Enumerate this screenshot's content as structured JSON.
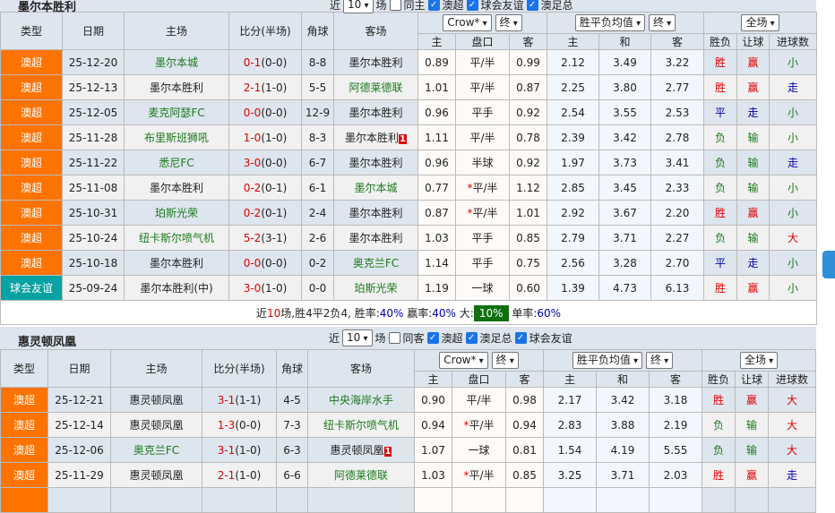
{
  "controls": {
    "recent_prefix": "近",
    "recent_count": "10",
    "recent_suffix": "场",
    "book": "Crow*",
    "stage": "终",
    "avg": "胜平负均值",
    "stage2": "终",
    "scope": "全场"
  },
  "headers": {
    "type": "类型",
    "date": "日期",
    "home": "主场",
    "score": "比分(半场)",
    "corner": "角球",
    "away": "客场",
    "h": "主",
    "line": "盘口",
    "a": "客",
    "oh": "主",
    "od": "和",
    "oa": "客",
    "wl": "胜负",
    "hc": "让球",
    "ou": "进球数"
  },
  "sections": [
    {
      "title": "墨尔本胜利",
      "same_label": "同主",
      "filters": [
        "澳超",
        "球会友谊",
        "澳足总"
      ],
      "rows": [
        [
          "澳超",
          "25-12-20",
          "墨尔本城",
          "0-1",
          "(0-0)",
          "8-8",
          "墨尔本胜利",
          "0.89",
          "平/半",
          "0.99",
          "2.12",
          "3.49",
          "3.22",
          "胜",
          "赢",
          "小"
        ],
        [
          "澳超",
          "25-12-13",
          "墨尔本胜利",
          "2-1",
          "(1-0)",
          "5-5",
          "阿德莱德联",
          "1.01",
          "平/半",
          "0.87",
          "2.25",
          "3.80",
          "2.77",
          "胜",
          "赢",
          "走"
        ],
        [
          "澳超",
          "25-12-05",
          "麦克阿瑟FC",
          "0-0",
          "(0-0)",
          "12-9",
          "墨尔本胜利",
          "0.96",
          "平手",
          "0.92",
          "2.54",
          "3.55",
          "2.53",
          "平",
          "走",
          "小"
        ],
        [
          "澳超",
          "25-11-28",
          "布里斯班狮吼",
          "1-0",
          "(1-0)",
          "8-3",
          "墨尔本胜利",
          "1.11",
          "平/半",
          "0.78",
          "2.39",
          "3.42",
          "2.78",
          "负",
          "输",
          "小"
        ],
        [
          "澳超",
          "25-11-22",
          "悉尼FC",
          "3-0",
          "(0-0)",
          "6-7",
          "墨尔本胜利",
          "0.96",
          "半球",
          "0.92",
          "1.97",
          "3.73",
          "3.41",
          "负",
          "输",
          "走"
        ],
        [
          "澳超",
          "25-11-08",
          "墨尔本胜利",
          "0-2",
          "(0-1)",
          "6-1",
          "墨尔本城",
          "0.77",
          "*平/半",
          "1.12",
          "2.85",
          "3.45",
          "2.33",
          "负",
          "输",
          "小"
        ],
        [
          "澳超",
          "25-10-31",
          "珀斯光荣",
          "0-2",
          "(0-1)",
          "2-4",
          "墨尔本胜利",
          "0.87",
          "*平/半",
          "1.01",
          "2.92",
          "3.67",
          "2.20",
          "胜",
          "赢",
          "小"
        ],
        [
          "澳超",
          "25-10-24",
          "纽卡斯尔喷气机",
          "5-2",
          "(3-1)",
          "2-6",
          "墨尔本胜利",
          "1.03",
          "平手",
          "0.85",
          "2.79",
          "3.71",
          "2.27",
          "负",
          "输",
          "大"
        ],
        [
          "澳超",
          "25-10-18",
          "墨尔本胜利",
          "0-0",
          "(0-0)",
          "0-2",
          "奥克兰FC",
          "1.14",
          "平手",
          "0.75",
          "2.56",
          "3.28",
          "2.70",
          "平",
          "走",
          "小"
        ],
        [
          "球会友谊",
          "25-09-24",
          "墨尔本胜利(中)",
          "3-0",
          "(1-0)",
          "0-0",
          "珀斯光荣",
          "1.19",
          "一球",
          "0.60",
          "1.39",
          "4.73",
          "6.13",
          "胜",
          "赢",
          "小"
        ]
      ],
      "home_team_side": [
        1,
        0,
        1,
        1,
        1,
        0,
        1,
        1,
        0,
        0
      ],
      "red_cards": {
        "3": "1"
      },
      "summary": {
        "p1": "近",
        "n": "10",
        "p2": "场,胜",
        "w": "4",
        "p3": "平",
        "d": "2",
        "p4": "负",
        "l": "4",
        "p5": ", 胜率:",
        "wr": "40%",
        "p6": " 赢率:",
        "hr": "40%",
        "p7": " 大:",
        "big": "10%",
        "p8": " 单率:",
        "odd": "60%"
      }
    },
    {
      "title": "惠灵顿凤凰",
      "same_label": "同客",
      "filters": [
        "澳超",
        "澳足总",
        "球会友谊"
      ],
      "rows": [
        [
          "澳超",
          "25-12-21",
          "惠灵顿凤凰",
          "3-1",
          "(1-1)",
          "4-5",
          "中央海岸水手",
          "0.90",
          "平/半",
          "0.98",
          "2.17",
          "3.42",
          "3.18",
          "胜",
          "赢",
          "大"
        ],
        [
          "澳超",
          "25-12-14",
          "惠灵顿凤凰",
          "1-3",
          "(0-0)",
          "7-3",
          "纽卡斯尔喷气机",
          "0.94",
          "*平/半",
          "0.94",
          "2.83",
          "3.88",
          "2.19",
          "负",
          "输",
          "大"
        ],
        [
          "澳超",
          "25-12-06",
          "奥克兰FC",
          "3-1",
          "(1-0)",
          "6-3",
          "惠灵顿凤凰",
          "1.07",
          "一球",
          "0.81",
          "1.54",
          "4.19",
          "5.55",
          "负",
          "输",
          "大"
        ],
        [
          "澳超",
          "25-11-29",
          "惠灵顿凤凰",
          "2-1",
          "(1-0)",
          "6-6",
          "阿德莱德联",
          "1.03",
          "*平/半",
          "0.85",
          "3.25",
          "3.71",
          "2.03",
          "胜",
          "赢",
          "走"
        ]
      ],
      "home_team_side": [
        0,
        0,
        1,
        0
      ],
      "red_cards": {
        "2": "1"
      }
    }
  ],
  "colors": {
    "league": "#ff7300",
    "friendly": "#07a2a2",
    "team": "#1a7a1a",
    "win": "#d00",
    "lose": "#1a7a1a",
    "draw": "#00a"
  }
}
